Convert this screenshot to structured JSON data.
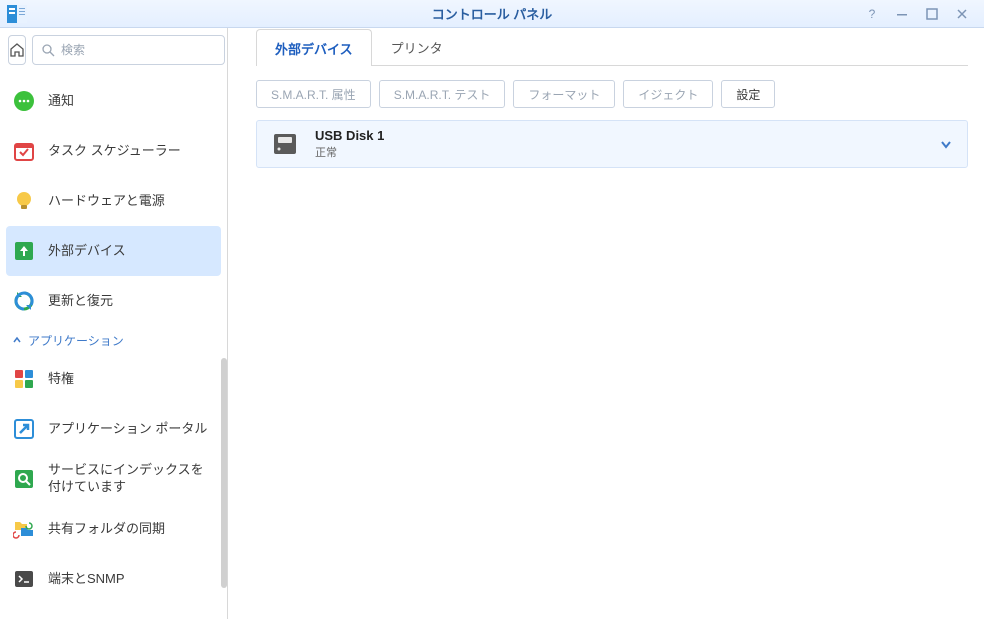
{
  "window": {
    "title": "コントロール パネル"
  },
  "search": {
    "placeholder": "検索"
  },
  "sidebar": {
    "items": [
      {
        "label": "通知"
      },
      {
        "label": "タスク スケジューラー"
      },
      {
        "label": "ハードウェアと電源"
      },
      {
        "label": "外部デバイス"
      },
      {
        "label": "更新と復元"
      }
    ],
    "section": "アプリケーション",
    "app_items": [
      {
        "label": "特権"
      },
      {
        "label": "アプリケーション ポータル"
      },
      {
        "label": "サービスにインデックスを付けています"
      },
      {
        "label": "共有フォルダの同期"
      },
      {
        "label": "端末とSNMP"
      }
    ]
  },
  "tabs": [
    {
      "label": "外部デバイス"
    },
    {
      "label": "プリンタ"
    }
  ],
  "toolbar": {
    "smart_attr": "S.M.A.R.T. 属性",
    "smart_test": "S.M.A.R.T. テスト",
    "format": "フォーマット",
    "eject": "イジェクト",
    "settings": "設定"
  },
  "device": {
    "name": "USB Disk 1",
    "status": "正常"
  }
}
